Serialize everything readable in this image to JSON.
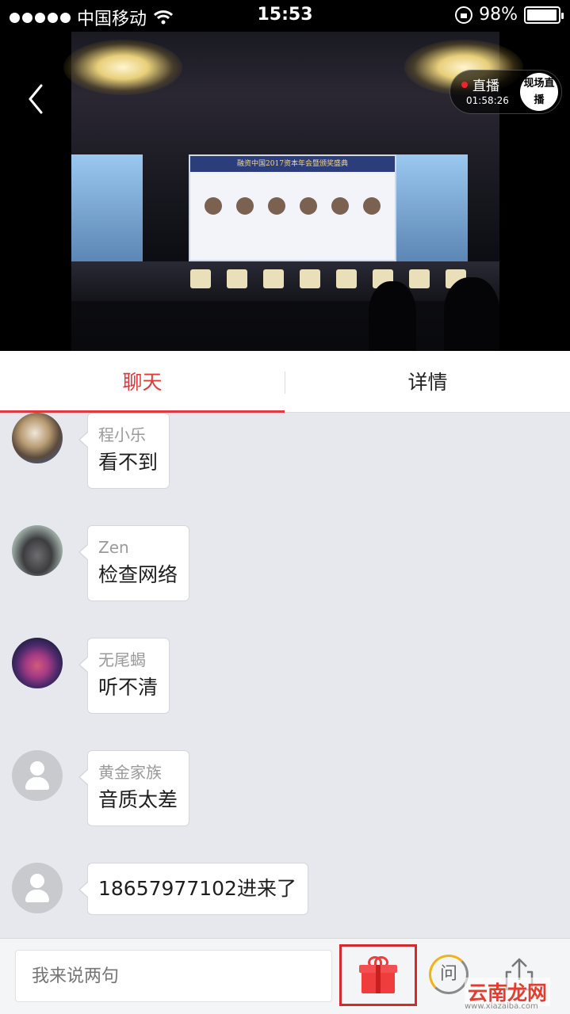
{
  "status_bar": {
    "carrier": "中国移动",
    "time": "15:53",
    "battery": "98%",
    "battery_level": 0.98
  },
  "video": {
    "live_label": "直播",
    "live_time": "01:58:26",
    "logo_text": "现场直播",
    "screen_banner": "融资中国2017资本年会暨颁奖盛典"
  },
  "tabs": {
    "chat": "聊天",
    "detail": "详情",
    "active": "chat"
  },
  "messages": [
    {
      "name": "程小乐",
      "text": "看不到"
    },
    {
      "name": "Zen",
      "text": "检查网络"
    },
    {
      "name": "无尾蝎",
      "text": "听不清"
    },
    {
      "name": "黄金家族",
      "text": "音质太差"
    },
    {
      "name": "",
      "text": "18657977102进来了"
    }
  ],
  "bottom_bar": {
    "input_placeholder": "我来说两句",
    "qa_label": "问"
  },
  "watermark": {
    "text": "云南龙网",
    "url": "www.xiazaiba.com"
  },
  "colors": {
    "accent": "#e03a3a",
    "chat_bg": "#e6e8ed",
    "live_dot": "#f0242c"
  }
}
